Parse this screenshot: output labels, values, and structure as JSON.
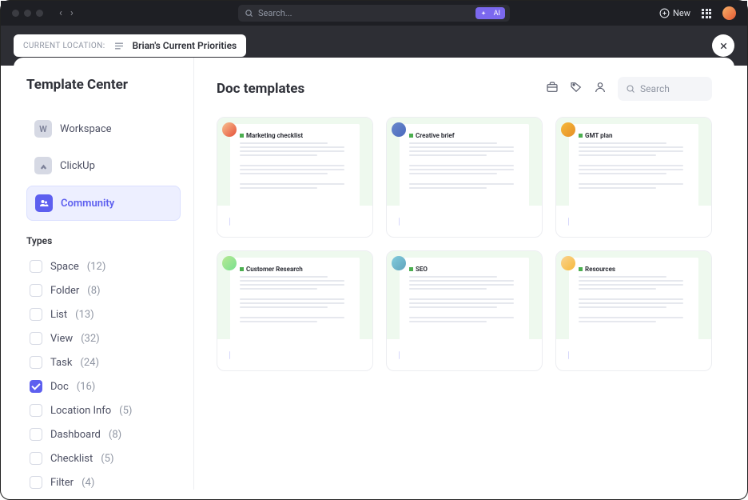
{
  "top": {
    "search_placeholder": "Search...",
    "ai_label": "AI",
    "new_label": "New"
  },
  "location": {
    "prefix": "CURRENT LOCATION:",
    "title": "Brian's Current Priorities"
  },
  "sidebar": {
    "title": "Template Center",
    "sources": [
      {
        "label": "Workspace",
        "badge": "W"
      },
      {
        "label": "ClickUp",
        "badge": ""
      },
      {
        "label": "Community",
        "badge": ""
      }
    ],
    "types_label": "Types",
    "types": [
      {
        "name": "Space",
        "count": "(12)",
        "checked": false
      },
      {
        "name": "Folder",
        "count": "(8)",
        "checked": false
      },
      {
        "name": "List",
        "count": "(13)",
        "checked": false
      },
      {
        "name": "View",
        "count": "(32)",
        "checked": false
      },
      {
        "name": "Task",
        "count": "(24)",
        "checked": false
      },
      {
        "name": "Doc",
        "count": "(16)",
        "checked": true
      },
      {
        "name": "Location Info",
        "count": "(5)",
        "checked": false
      },
      {
        "name": "Dashboard",
        "count": "(8)",
        "checked": false
      },
      {
        "name": "Checklist",
        "count": "(5)",
        "checked": false
      },
      {
        "name": "Filter",
        "count": "(4)",
        "checked": false
      }
    ]
  },
  "main": {
    "heading": "Doc templates",
    "search_placeholder": "Search",
    "templates": [
      {
        "label": "Marketing Checklist",
        "thumb_title": "Marketing checklist"
      },
      {
        "label": "Creative Brief",
        "thumb_title": "Creative brief"
      },
      {
        "label": "GMT Plan",
        "thumb_title": "GMT plan"
      },
      {
        "label": "Customer Research",
        "thumb_title": "Customer Research"
      },
      {
        "label": "SEO",
        "thumb_title": "SEO"
      },
      {
        "label": "Resources",
        "thumb_title": "Resources"
      }
    ]
  }
}
